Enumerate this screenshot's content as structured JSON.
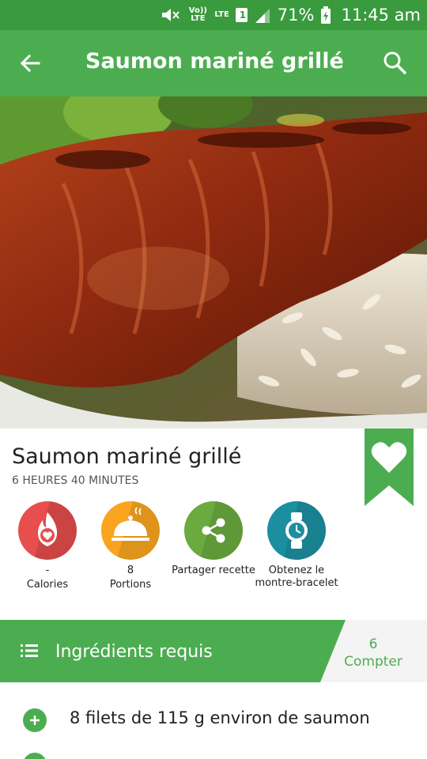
{
  "status_bar": {
    "volte": "Vo)) LTE",
    "lte": "LTE",
    "sim": "1",
    "battery": "71%",
    "time": "11:45 am"
  },
  "app_bar": {
    "title": "Saumon mariné grillé"
  },
  "recipe": {
    "name": "Saumon mariné grillé",
    "duration": "6 HEURES 40 MINUTES"
  },
  "actions": [
    {
      "value": "-",
      "label": "Calories",
      "color": "#e84e4e",
      "icon": "calorie-flame-icon"
    },
    {
      "value": "8",
      "label": "Portions",
      "color": "#f8a41e",
      "icon": "serving-cloche-icon"
    },
    {
      "label": "Partager recette",
      "color": "#6aaa3e",
      "icon": "share-icon"
    },
    {
      "label": "Obtenez le montre-bracelet",
      "color": "#1b8fa0",
      "icon": "watch-icon"
    }
  ],
  "ingredients": {
    "header": "Ingrédients requis",
    "count_value": "6",
    "count_label": "Compter",
    "items": [
      "8 filets de 115 g environ de saumon",
      ""
    ]
  },
  "colors": {
    "primary": "#4cad50",
    "status_bar": "#3a9a3e"
  }
}
